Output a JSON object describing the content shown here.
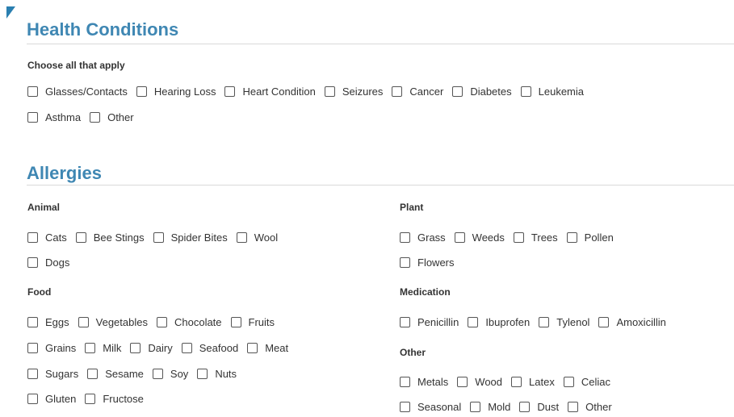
{
  "health": {
    "title": "Health Conditions",
    "instruction": "Choose all that apply",
    "row1": [
      "Glasses/Contacts",
      "Hearing Loss",
      "Heart Condition",
      "Seizures",
      "Cancer",
      "Diabetes",
      "Leukemia"
    ],
    "row2": [
      "Asthma",
      "Other"
    ]
  },
  "allergies": {
    "title": "Allergies",
    "animal": {
      "label": "Animal",
      "row1": [
        "Cats",
        "Bee Stings",
        "Spider Bites",
        "Wool"
      ],
      "row2": [
        "Dogs"
      ]
    },
    "food": {
      "label": "Food",
      "row1": [
        "Eggs",
        "Vegetables",
        "Chocolate",
        "Fruits"
      ],
      "row2": [
        "Grains",
        "Milk",
        "Dairy",
        "Seafood",
        "Meat"
      ],
      "row3": [
        "Sugars",
        "Sesame",
        "Soy",
        "Nuts"
      ],
      "row4": [
        "Gluten",
        "Fructose"
      ]
    },
    "plant": {
      "label": "Plant",
      "row1": [
        "Grass",
        "Weeds",
        "Trees",
        "Pollen"
      ],
      "row2": [
        "Flowers"
      ]
    },
    "medication": {
      "label": "Medication",
      "row1": [
        "Penicillin",
        "Ibuprofen",
        "Tylenol",
        "Amoxicillin"
      ]
    },
    "other": {
      "label": "Other",
      "row1": [
        "Metals",
        "Wood",
        "Latex",
        "Celiac"
      ],
      "row2": [
        "Seasonal",
        "Mold",
        "Dust",
        "Other"
      ]
    }
  }
}
